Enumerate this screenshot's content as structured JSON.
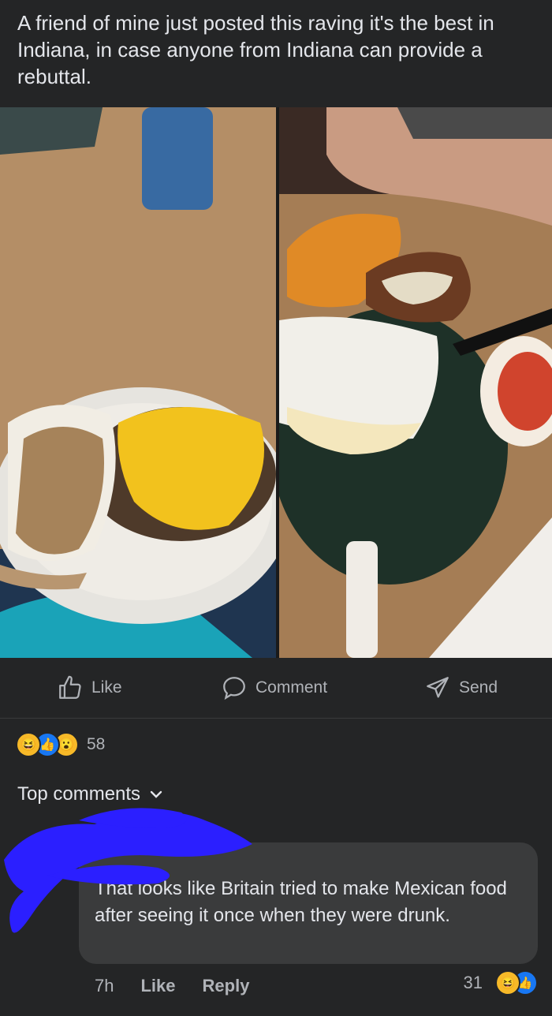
{
  "post": {
    "text": "A friend of mine just posted this raving it's the best in Indiana,  in case anyone from Indiana can provide a rebuttal."
  },
  "actions": {
    "like_label": "Like",
    "comment_label": "Comment",
    "send_label": "Send"
  },
  "reactions": {
    "icons": [
      "haha",
      "like",
      "wow"
    ],
    "count": "58"
  },
  "comments": {
    "header": "Top comments",
    "items": [
      {
        "text": "That looks like Britain tried to make Mexican food after seeing it once when they were drunk.",
        "time": "7h",
        "like_label": "Like",
        "reply_label": "Reply",
        "reaction_count": "31",
        "reaction_icons": [
          "haha",
          "like"
        ]
      }
    ]
  },
  "colors": {
    "background": "#242526",
    "bubble": "#3a3b3c",
    "muted_text": "#b0b3b8",
    "scribble": "#2b1fff"
  }
}
